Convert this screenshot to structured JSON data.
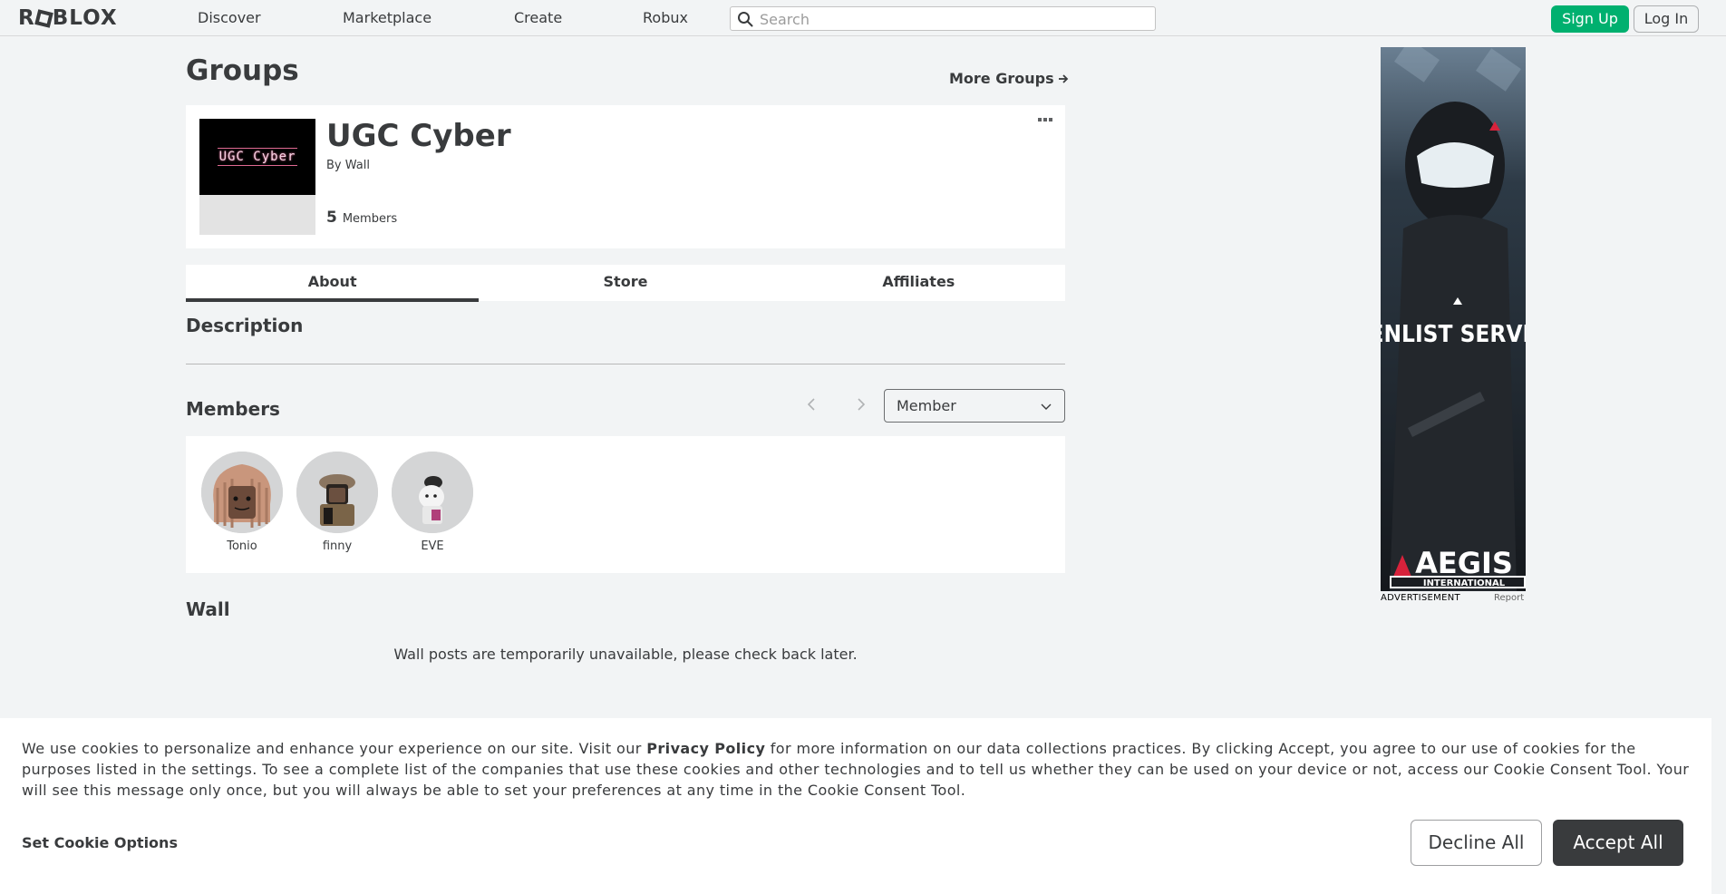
{
  "nav": {
    "logo": "ROBLOX",
    "links": [
      "Discover",
      "Marketplace",
      "Create",
      "Robux"
    ],
    "search_placeholder": "Search",
    "signup_label": "Sign Up",
    "login_label": "Log In"
  },
  "header": {
    "title": "Groups",
    "more_groups": "More Groups"
  },
  "group": {
    "emblem_text": "UGC Cyber",
    "name": "UGC Cyber",
    "by_prefix": "By",
    "owner": "Wall",
    "member_count": "5",
    "member_label": "Members"
  },
  "tabs": [
    "About",
    "Store",
    "Affiliates"
  ],
  "active_tab": "About",
  "sections": {
    "description": "Description",
    "members": "Members",
    "wall": "Wall"
  },
  "members": {
    "role_selected": "Member",
    "list": [
      {
        "name": "Tonio"
      },
      {
        "name": "finny"
      },
      {
        "name": "EVE"
      }
    ]
  },
  "wall": {
    "message": "Wall posts are temporarily unavailable, please check back later."
  },
  "ad": {
    "headline": "ENLIST SERVE",
    "brand": "AEGIS",
    "brand_sub": "INTERNATIONAL",
    "label": "ADVERTISEMENT",
    "report": "Report"
  },
  "cookie": {
    "text_before": "We use cookies to personalize and enhance your experience on our site. Visit our ",
    "policy_link": "Privacy Policy",
    "text_after": " for more information on our data collections practices. By clicking Accept, you agree to our use of cookies for the purposes listed in the settings. To see a complete list of the companies that use these cookies and other technologies and to tell us whether they can be used on your device or not, access our Cookie Consent Tool. Your will see this message only once, but you will always be able to set your preferences at any time in the Cookie Consent Tool.",
    "set_options": "Set Cookie Options",
    "decline": "Decline All",
    "accept": "Accept All"
  },
  "colors": {
    "accent_green": "#00b06f",
    "text_dark": "#393b3d",
    "background": "#f2f4f5"
  }
}
